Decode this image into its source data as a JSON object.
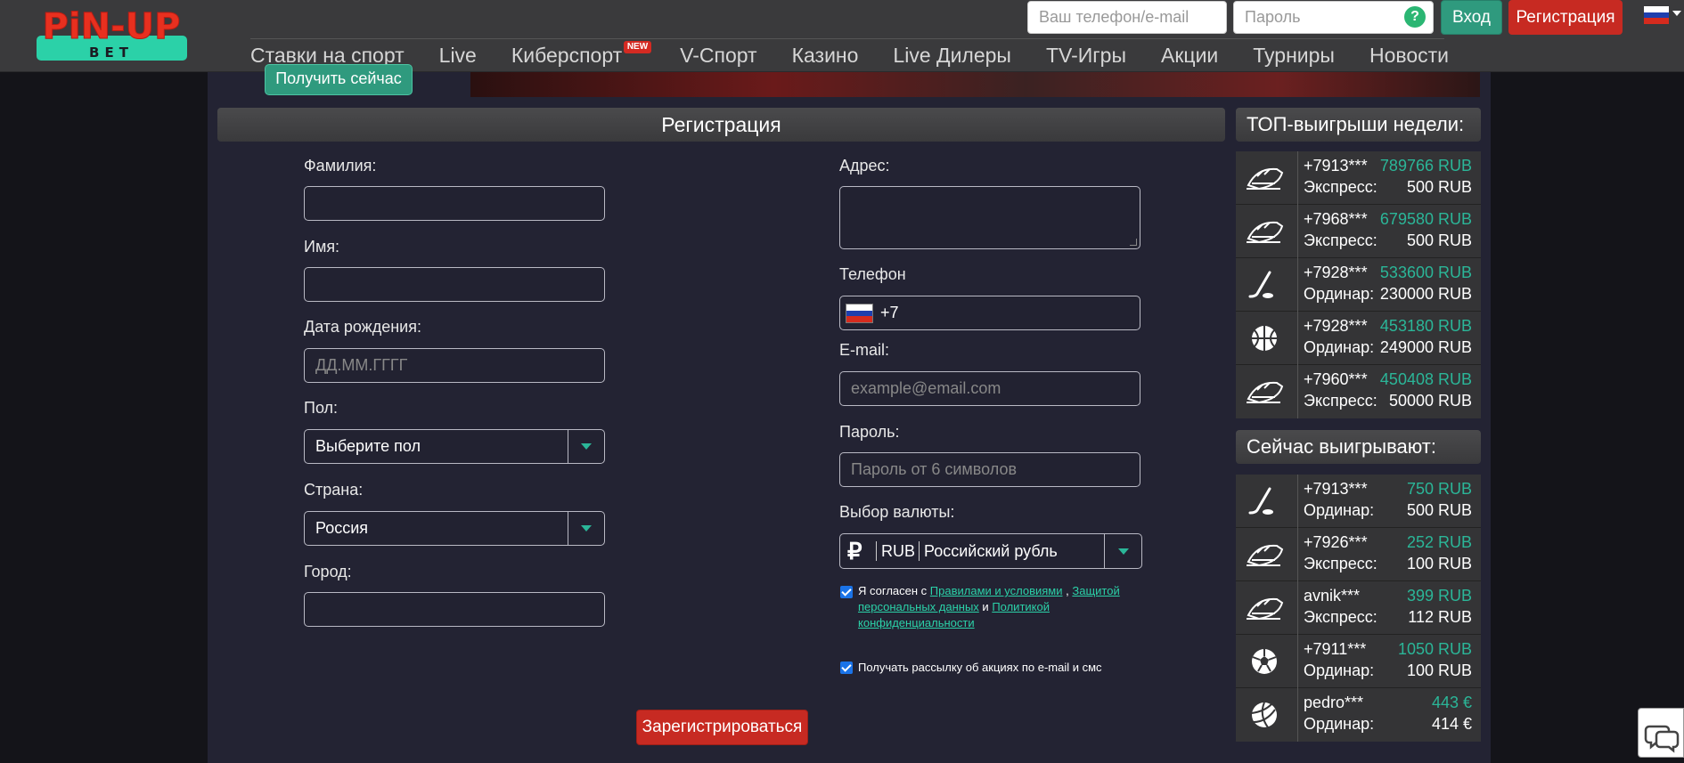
{
  "header": {
    "logo_text": "PiN-UP",
    "logo_sub": "BET",
    "phone_placeholder": "Ваш телефон/e-mail",
    "password_placeholder": "Пароль",
    "help_symbol": "?",
    "login_label": "Вход",
    "register_label": "Регистрация",
    "language": "ru"
  },
  "nav": {
    "items": [
      {
        "label": "Ставки на спорт"
      },
      {
        "label": "Live"
      },
      {
        "label": "Киберспорт",
        "badge": "NEW"
      },
      {
        "label": "V-Спорт"
      },
      {
        "label": "Казино"
      },
      {
        "label": "Live Дилеры"
      },
      {
        "label": "TV-Игры"
      },
      {
        "label": "Акции"
      },
      {
        "label": "Турниры"
      },
      {
        "label": "Новости"
      }
    ]
  },
  "banner": {
    "cta_label": "Получить сейчас"
  },
  "registration": {
    "title": "Регистрация",
    "left": {
      "surname_label": "Фамилия:",
      "name_label": "Имя:",
      "birthdate_label": "Дата рождения:",
      "birthdate_placeholder": "ДД.ММ.ГГГГ",
      "gender_label": "Пол:",
      "gender_value": "Выберите пол",
      "country_label": "Страна:",
      "country_value": "Россия",
      "city_label": "Город:"
    },
    "right": {
      "address_label": "Адрес:",
      "phone_label": "Телефон",
      "phone_prefix": "+7",
      "email_label": "E-mail:",
      "email_placeholder": "example@email.com",
      "password_label": "Пароль:",
      "password_placeholder": "Пароль от 6 символов",
      "currency_label": "Выбор валюты:",
      "currency_symbol": "₽",
      "currency_code": "RUB",
      "currency_name": "Российский рубль"
    },
    "agree": {
      "prefix": "Я согласен с",
      "rules_link": "Правилами и условиями",
      "comma": ",",
      "privacy_link": "Защитой персональных данных",
      "and": "и",
      "policy_link": "Политикой конфиденциальности",
      "checked": true
    },
    "mailing": {
      "label": "Получать рассылку об акциях по e-mail и смс",
      "checked": true
    },
    "submit_label": "Зарегистрироваться"
  },
  "sidebar": {
    "top_title": "ТОП-выигрыши недели:",
    "top_wins": [
      {
        "icon": "rocket-icon",
        "user": "+7913***",
        "amount": "789766 RUB",
        "type": "Экспресс:",
        "stake": "500 RUB"
      },
      {
        "icon": "rocket-icon",
        "user": "+7968***",
        "amount": "679580 RUB",
        "type": "Экспресс:",
        "stake": "500 RUB"
      },
      {
        "icon": "hockey-icon",
        "user": "+7928***",
        "amount": "533600 RUB",
        "type": "Ординар:",
        "stake": "230000 RUB"
      },
      {
        "icon": "basketball-icon",
        "user": "+7928***",
        "amount": "453180 RUB",
        "type": "Ординар:",
        "stake": "249000 RUB"
      },
      {
        "icon": "rocket-icon",
        "user": "+7960***",
        "amount": "450408 RUB",
        "type": "Экспресс:",
        "stake": "50000 RUB"
      }
    ],
    "now_title": "Сейчас выигрывают:",
    "now_wins": [
      {
        "icon": "hockey-icon",
        "user": "+7913***",
        "amount": "750 RUB",
        "type": "Ординар:",
        "stake": "500 RUB"
      },
      {
        "icon": "rocket-icon",
        "user": "+7926***",
        "amount": "252 RUB",
        "type": "Экспресс:",
        "stake": "100 RUB"
      },
      {
        "icon": "rocket-icon",
        "user": "avnik***",
        "amount": "399 RUB",
        "type": "Экспресс:",
        "stake": "112 RUB"
      },
      {
        "icon": "soccer-icon",
        "user": "+7911***",
        "amount": "1050 RUB",
        "type": "Ординар:",
        "stake": "100 RUB"
      },
      {
        "icon": "volleyball-icon",
        "user": "pedro***",
        "amount": "443 €",
        "type": "Ординар:",
        "stake": "414 €"
      }
    ]
  },
  "colors": {
    "accent": "#2bb698",
    "brand_red": "#c72a22",
    "green_button": "#2f9a7e"
  }
}
